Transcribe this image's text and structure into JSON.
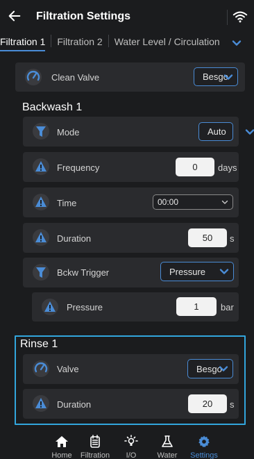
{
  "header": {
    "title": "Filtration Settings"
  },
  "tabs": [
    {
      "label": "Filtration 1"
    },
    {
      "label": "Filtration 2"
    },
    {
      "label": "Water Level / Circulation"
    }
  ],
  "clean_valve": {
    "label": "Clean Valve",
    "value": "Besgo"
  },
  "backwash": {
    "title": "Backwash 1",
    "mode": {
      "label": "Mode",
      "value": "Auto"
    },
    "frequency": {
      "label": "Frequency",
      "value": "0",
      "unit": "days"
    },
    "time": {
      "label": "Time",
      "value": "00:00"
    },
    "duration": {
      "label": "Duration",
      "value": "50",
      "unit": "s"
    },
    "trigger": {
      "label": "Bckw Trigger",
      "value": "Pressure"
    },
    "pressure": {
      "label": "Pressure",
      "value": "1",
      "unit": "bar"
    }
  },
  "rinse": {
    "title": "Rinse 1",
    "valve": {
      "label": "Valve",
      "value": "Besgo"
    },
    "duration": {
      "label": "Duration",
      "value": "20",
      "unit": "s"
    }
  },
  "nav": [
    {
      "label": "Home",
      "icon": "home-icon"
    },
    {
      "label": "Filtration",
      "icon": "filtration-icon"
    },
    {
      "label": "I/O",
      "icon": "bulb-icon"
    },
    {
      "label": "Water",
      "icon": "flask-icon"
    },
    {
      "label": "Settings",
      "icon": "gear-icon"
    }
  ],
  "colors": {
    "accent": "#4a8cd6",
    "highlight_border": "#32a6dd",
    "card": "#2a2b2e",
    "background": "#1b1c1e"
  }
}
